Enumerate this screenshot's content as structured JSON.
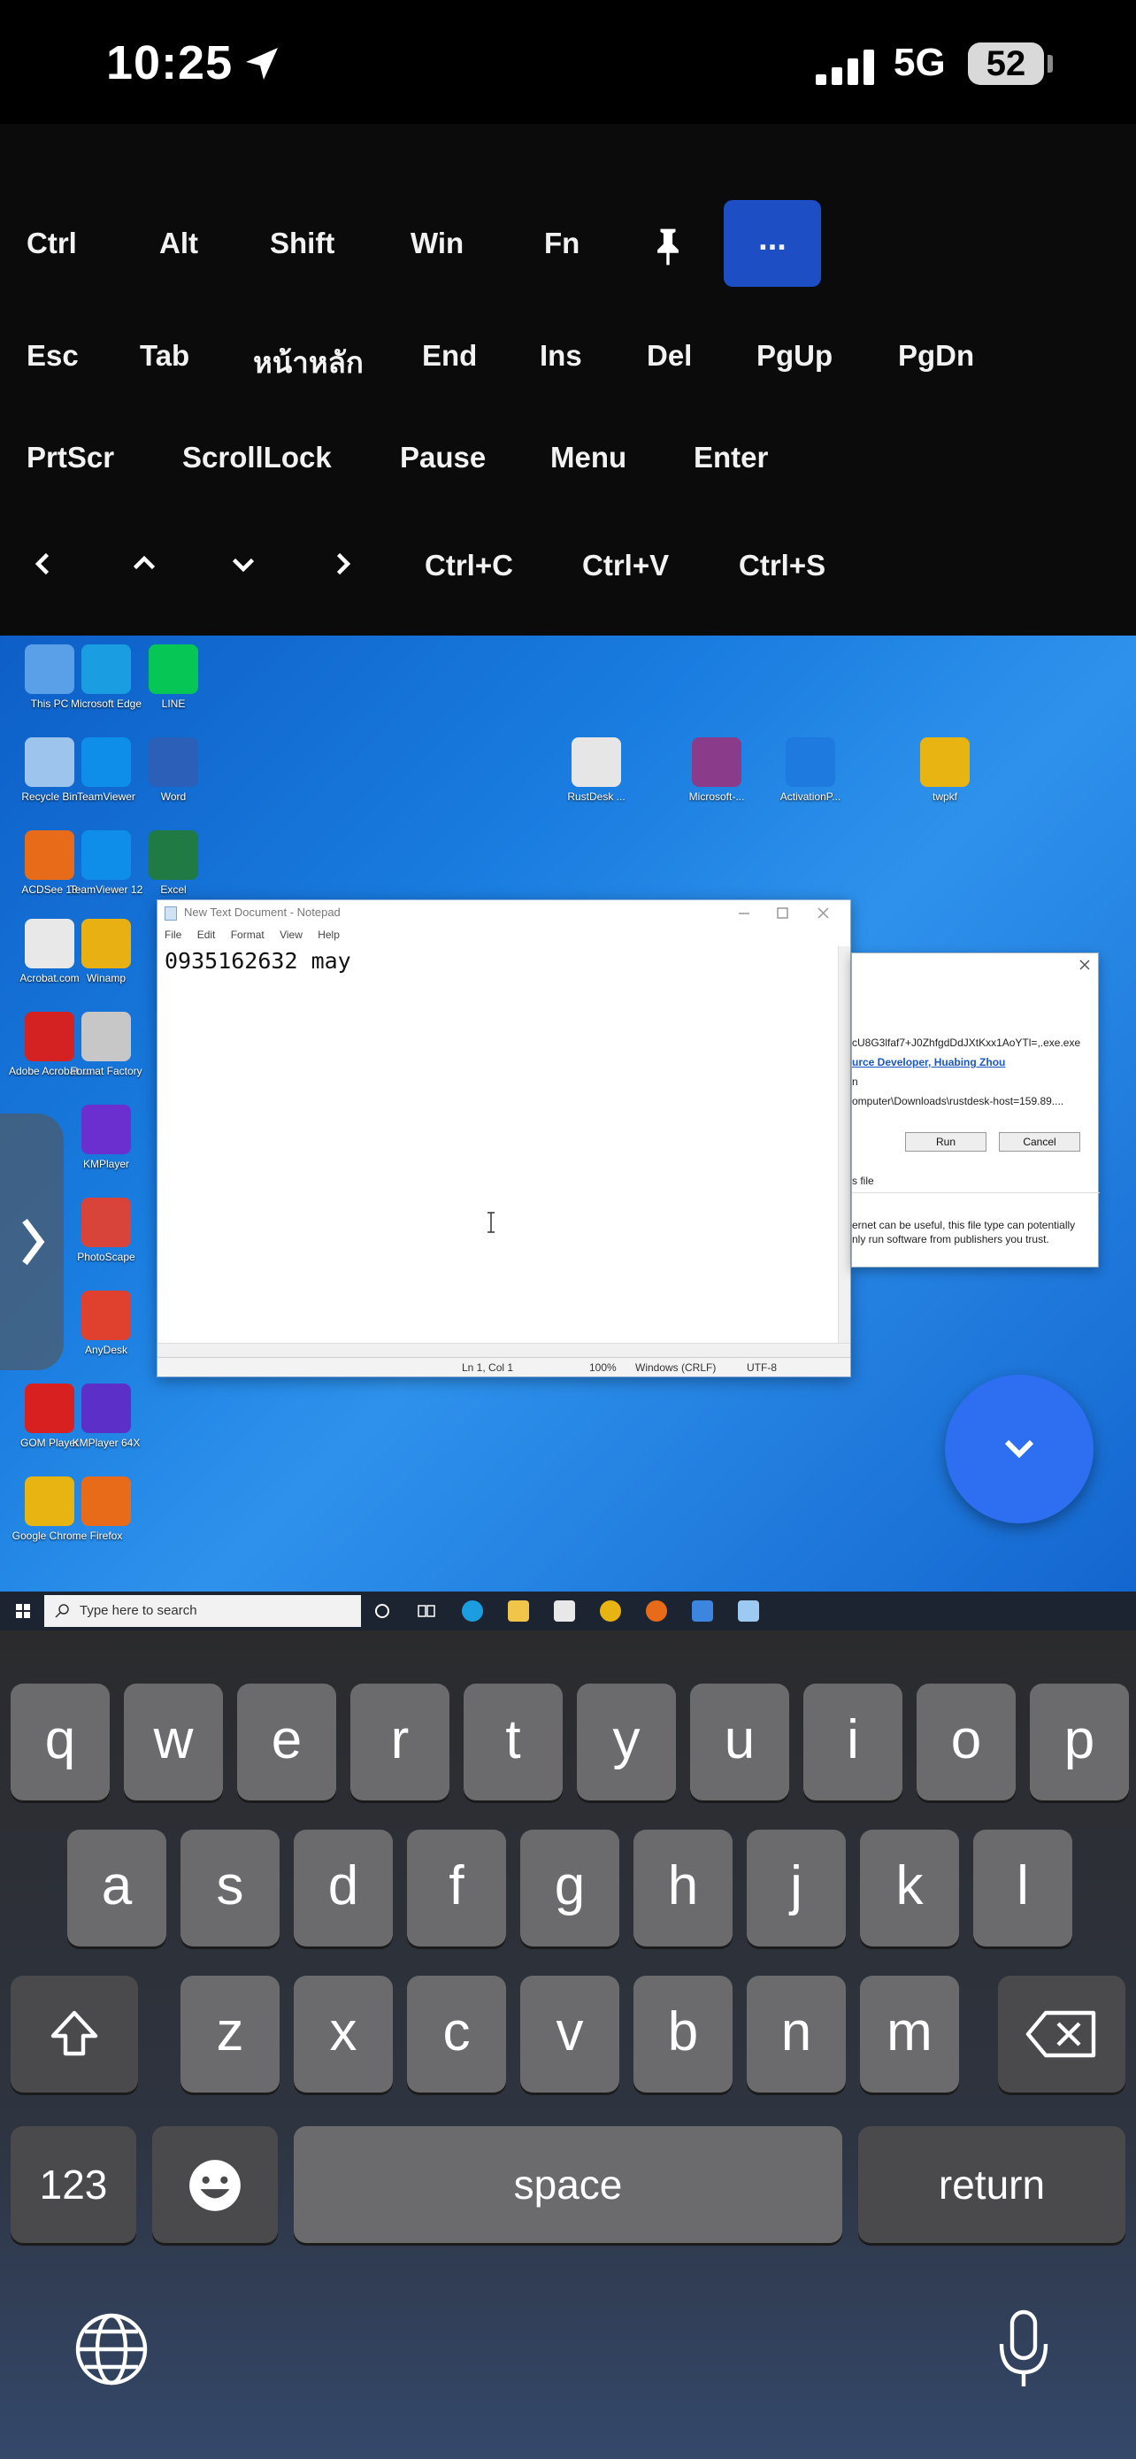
{
  "status": {
    "time": "10:25",
    "network": "5G",
    "battery": "52"
  },
  "toolbar": {
    "row1": [
      "Ctrl",
      "Alt",
      "Shift",
      "Win",
      "Fn"
    ],
    "more": "...",
    "row2": [
      "Esc",
      "Tab",
      "หน้าหลัก",
      "End",
      "Ins",
      "Del",
      "PgUp",
      "PgDn"
    ],
    "row3": [
      "PrtScr",
      "ScrollLock",
      "Pause",
      "Menu",
      "Enter"
    ],
    "row4": [
      "Ctrl+C",
      "Ctrl+V",
      "Ctrl+S"
    ]
  },
  "desktop": {
    "icons": [
      {
        "label": "This PC",
        "color": "#5aa0e8"
      },
      {
        "label": "Microsoft Edge",
        "color": "#1b9de2"
      },
      {
        "label": "LINE",
        "color": "#06c755"
      },
      {
        "label": "Recycle Bin",
        "color": "#9cc4ec"
      },
      {
        "label": "TeamViewer",
        "color": "#0e8ee9"
      },
      {
        "label": "Word",
        "color": "#2b5fb8"
      },
      {
        "label": "ACDSee 18",
        "color": "#e86b1a"
      },
      {
        "label": "TeamViewer 12",
        "color": "#0e8ee9"
      },
      {
        "label": "Excel",
        "color": "#1f7a44"
      },
      {
        "label": "Acrobat.com",
        "color": "#e8e8e8"
      },
      {
        "label": "Winamp",
        "color": "#e8b012"
      },
      {
        "label": "Adobe Acrobat ...",
        "color": "#d42121"
      },
      {
        "label": "Format Factory",
        "color": "#c7c7c7"
      },
      {
        "label": "KMPlayer",
        "color": "#6b2fd0"
      },
      {
        "label": "PhotoScape",
        "color": "#d8443a"
      },
      {
        "label": "AnyDesk",
        "color": "#e0402e"
      },
      {
        "label": "GOM Player",
        "color": "#d82020"
      },
      {
        "label": "KMPlayer 64X",
        "color": "#5b2fc8"
      },
      {
        "label": "Google Chrome",
        "color": "#e8b412"
      },
      {
        "label": "Firefox",
        "color": "#e86b1a"
      },
      {
        "label": "RustDesk ...",
        "color": "#e6e6e6"
      },
      {
        "label": "Microsoft-...",
        "color": "#8a3b8a"
      },
      {
        "label": "ActivationP...",
        "color": "#1f7ae0"
      },
      {
        "label": "twpkf",
        "color": "#e8b412"
      }
    ]
  },
  "notepad": {
    "title": "New Text Document - Notepad",
    "menu": [
      "File",
      "Edit",
      "Format",
      "View",
      "Help"
    ],
    "content": "0935162632 may",
    "status": {
      "pos": "Ln 1, Col 1",
      "zoom": "100%",
      "eol": "Windows (CRLF)",
      "enc": "UTF-8"
    }
  },
  "dialog": {
    "name_line": "cU8G3lfaf7+J0ZhfgdDdJXtKxx1AoYTl=,.exe.exe",
    "publisher": "urce Developer, Huabing Zhou",
    "type_label": "n",
    "from_line": "omputer\\Downloads\\rustdesk-host=159.89....",
    "run": "Run",
    "cancel": "Cancel",
    "checkbox_text": "s file",
    "warning1": "ernet can be useful, this file type can potentially",
    "warning2": "nly run software from publishers you trust."
  },
  "taskbar": {
    "search_placeholder": "Type here to search"
  },
  "keyboard": {
    "row1": [
      "q",
      "w",
      "e",
      "r",
      "t",
      "y",
      "u",
      "i",
      "o",
      "p"
    ],
    "row2": [
      "a",
      "s",
      "d",
      "f",
      "g",
      "h",
      "j",
      "k",
      "l"
    ],
    "row3": [
      "z",
      "x",
      "c",
      "v",
      "b",
      "n",
      "m"
    ],
    "numbers": "123",
    "space": "space",
    "return": "return"
  }
}
